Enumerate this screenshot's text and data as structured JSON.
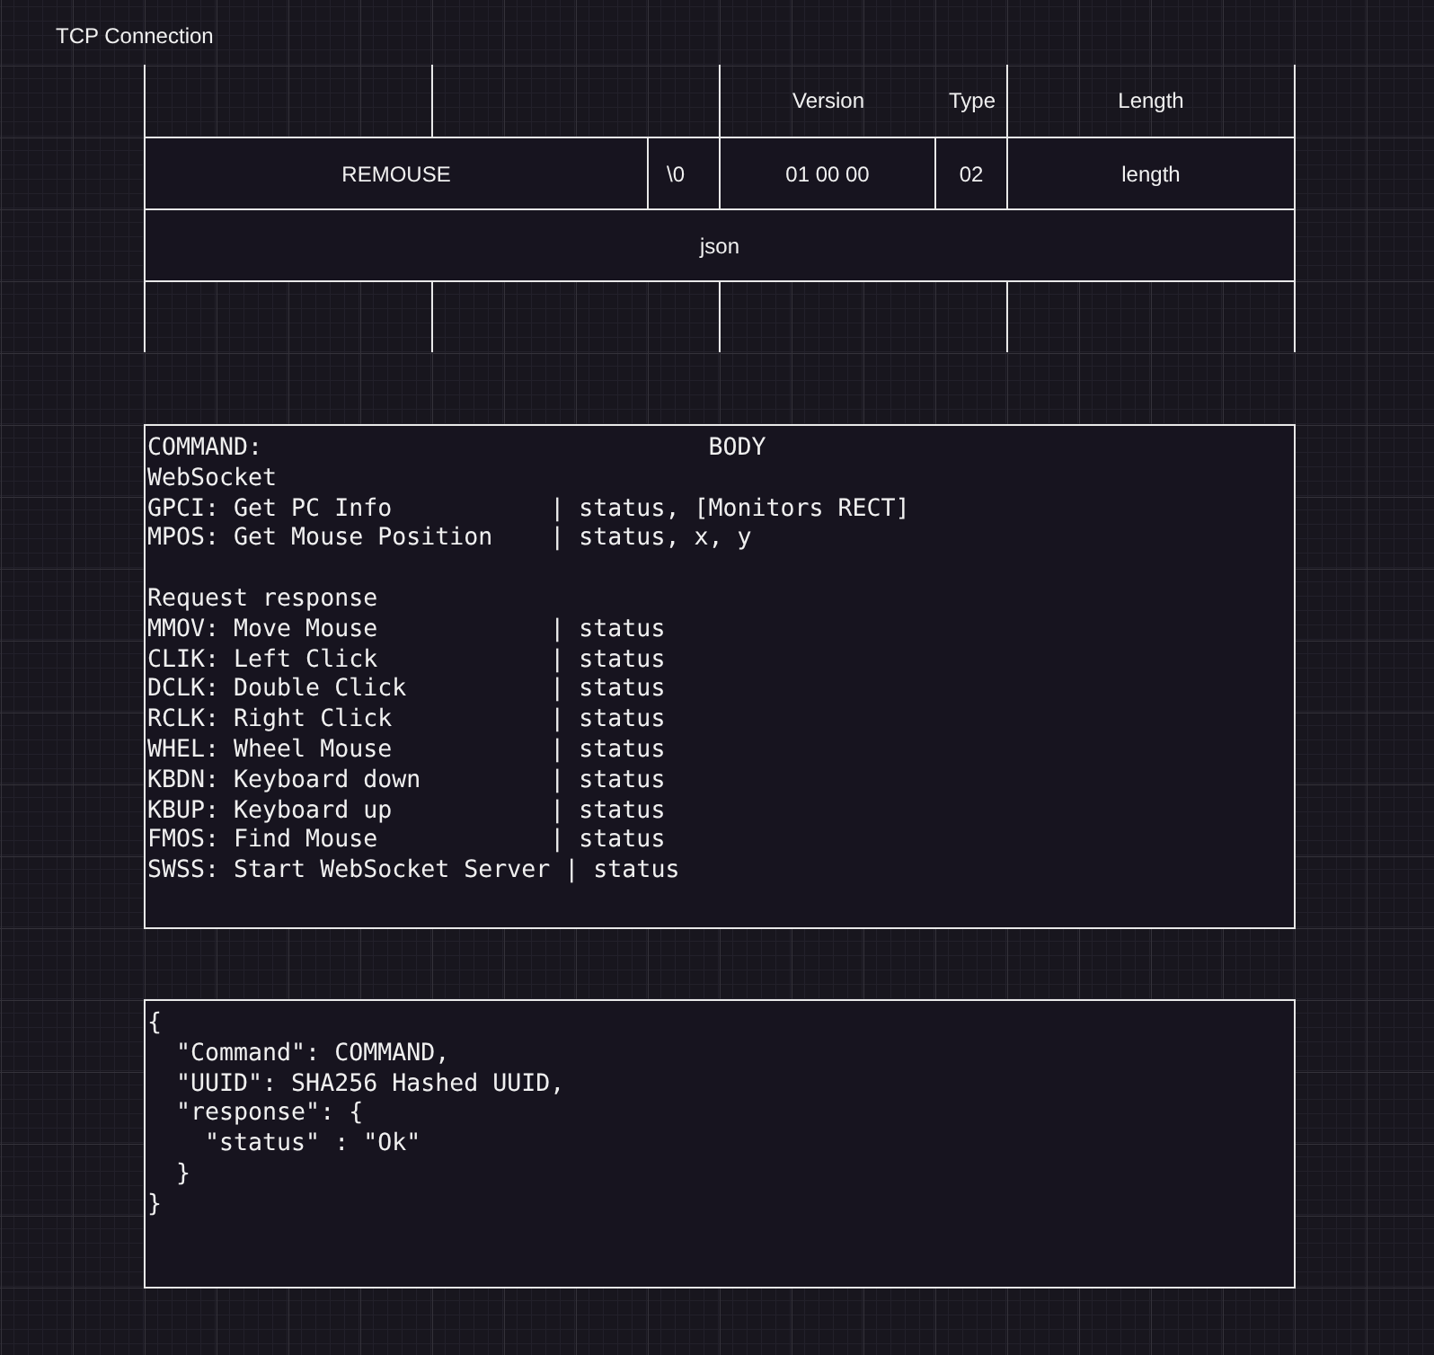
{
  "title": "TCP Connection",
  "packet_table": {
    "header_row": {
      "version": "Version",
      "type": "Type",
      "length": "Length"
    },
    "field_row": [
      "REMOUSE",
      "\\0",
      "01 00 00",
      "02",
      "length"
    ],
    "payload_row": "json"
  },
  "command_box": {
    "heading": "COMMAND:",
    "body_heading": "BODY",
    "sections": [
      {
        "title": "WebSocket",
        "lines": [
          "GPCI: Get PC Info           | status, [Monitors RECT]",
          "MPOS: Get Mouse Position    | status, x, y"
        ]
      },
      {
        "title": "Request response",
        "lines": [
          "MMOV: Move Mouse            | status",
          "CLIK: Left Click            | status",
          "DCLK: Double Click          | status",
          "RCLK: Right Click           | status",
          "WHEL: Wheel Mouse           | status",
          "KBDN: Keyboard down         | status",
          "KBUP: Keyboard up           | status",
          "FMOS: Find Mouse            | status",
          "SWSS: Start WebSocket Server | status"
        ]
      }
    ]
  },
  "json_box": {
    "lines": [
      "{",
      "  \"Command\": COMMAND,",
      "  \"UUID\": SHA256 Hashed UUID,",
      "  \"response\": {",
      "    \"status\" : \"Ok\"",
      "  }",
      "}"
    ]
  }
}
